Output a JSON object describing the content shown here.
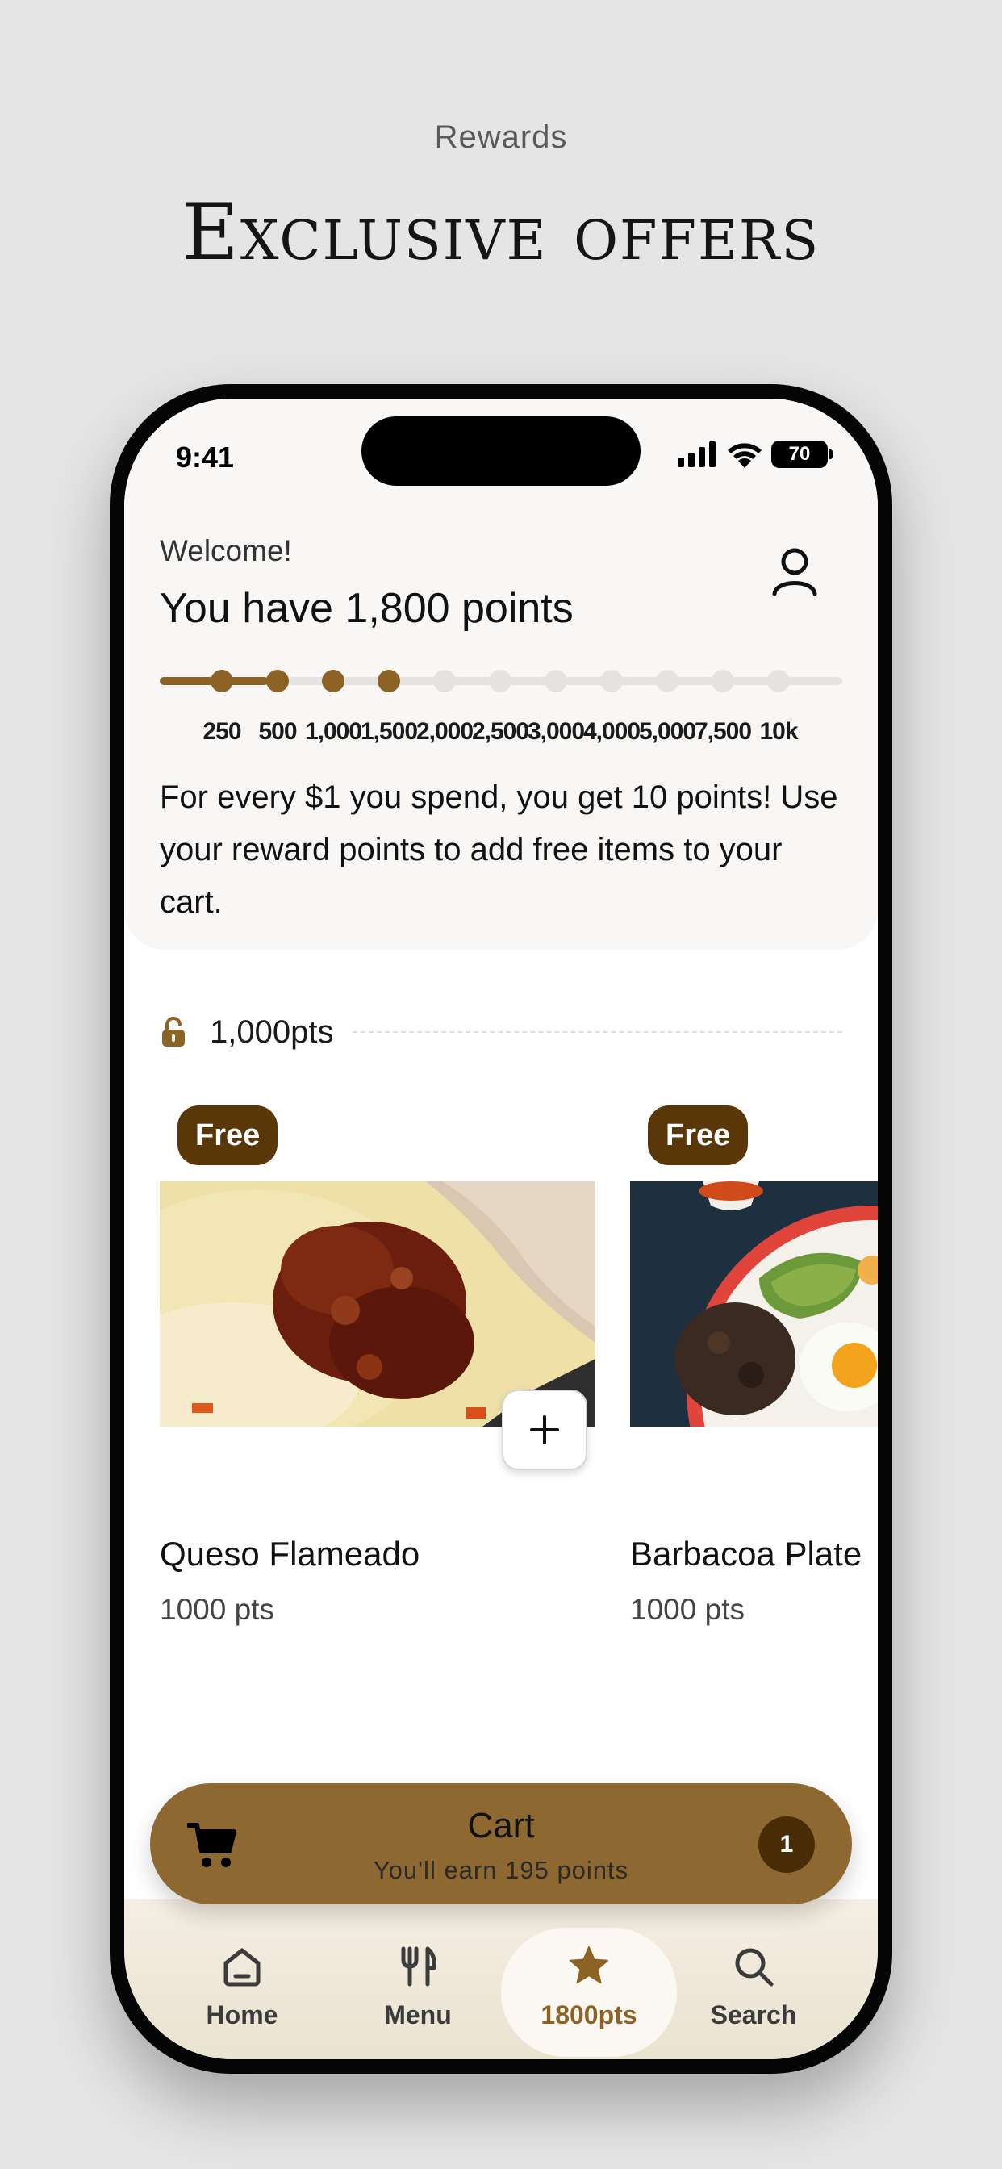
{
  "promo": {
    "kicker": "Rewards",
    "title": "Exclusive offers"
  },
  "status_bar": {
    "time": "9:41",
    "battery": "70"
  },
  "header": {
    "welcome": "Welcome!",
    "points_headline": "You have 1,800 points",
    "profile_icon": "person-icon"
  },
  "progress": {
    "milestones": [
      "250",
      "500",
      "1,000",
      "1,500",
      "2,000",
      "2,500",
      "3,000",
      "4,000",
      "5,000",
      "7,500",
      "10k"
    ],
    "reached_count": 4,
    "fill_fraction": 0.16
  },
  "info": {
    "text": "For every $1 you spend, you get 10 points! Use your reward points to add free items to your cart."
  },
  "tier": {
    "label": "1,000pts",
    "icon": "unlock-icon"
  },
  "items": [
    {
      "badge": "Free",
      "name": "Queso Flameado",
      "price": "1000 pts"
    },
    {
      "badge": "Free",
      "name": "Barbacoa Plate",
      "price": "1000 pts"
    }
  ],
  "cart": {
    "title": "Cart",
    "subtitle": "You'll earn 195 points",
    "count": "1",
    "icon": "cart-icon"
  },
  "nav": [
    {
      "label": "Home",
      "icon": "home-icon"
    },
    {
      "label": "Menu",
      "icon": "fork-knife-icon"
    },
    {
      "label": "1800pts",
      "icon": "star-icon"
    },
    {
      "label": "Search",
      "icon": "search-icon"
    }
  ],
  "colors": {
    "accent": "#8c6325",
    "badge": "#5a3709",
    "cart_bar": "#8d6830"
  }
}
